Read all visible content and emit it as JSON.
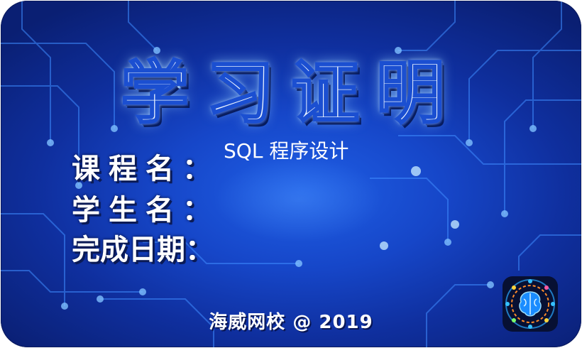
{
  "certificate": {
    "title": "学习证明",
    "course_label": "课程名：",
    "student_label": "学生名：",
    "date_label": "完成日期：",
    "course_value": "SQL 程序设计",
    "student_value": "",
    "date_value": "",
    "footer": "海威网校 @ 2019"
  },
  "logo": {
    "icon": "brain-circuit-logo-icon"
  },
  "colors": {
    "background_center": "#1f5fe6",
    "background_edge": "#0a1f73",
    "text": "#ffffff",
    "title_glow": "#bfe0ff"
  }
}
